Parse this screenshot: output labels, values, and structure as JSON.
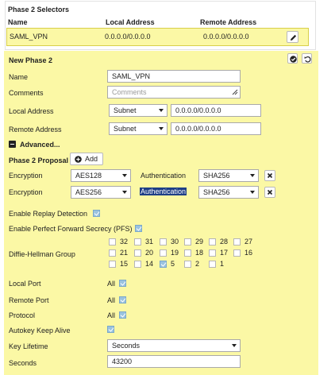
{
  "selectors": {
    "title": "Phase 2 Selectors",
    "headers": {
      "name": "Name",
      "local": "Local Address",
      "remote": "Remote Address"
    },
    "row": {
      "name": "SAML_VPN",
      "local": "0.0.0.0/0.0.0.0",
      "remote": "0.0.0.0/0.0.0.0"
    }
  },
  "panel": {
    "title": "New Phase 2",
    "name": {
      "label": "Name",
      "value": "SAML_VPN"
    },
    "comments": {
      "label": "Comments",
      "placeholder": "Comments"
    },
    "local": {
      "label": "Local Address",
      "type": "Subnet",
      "value": "0.0.0.0/0.0.0.0"
    },
    "remote": {
      "label": "Remote Address",
      "type": "Subnet",
      "value": "0.0.0.0/0.0.0.0"
    },
    "advanced": "Advanced...",
    "proposal": {
      "label": "Phase 2 Proposal",
      "add": "Add",
      "rows": [
        {
          "enc_label": "Encryption",
          "enc": "AES128",
          "auth_label": "Authentication",
          "auth": "SHA256"
        },
        {
          "enc_label": "Encryption",
          "enc": "AES256",
          "auth_label": "Authentication",
          "auth": "SHA256"
        }
      ]
    },
    "replay": {
      "label": "Enable Replay Detection",
      "checked": true
    },
    "pfs": {
      "label": "Enable Perfect Forward Secrecy (PFS)",
      "checked": true
    },
    "dh": {
      "label": "Diffie-Hellman Group",
      "groups": [
        {
          "n": "32",
          "checked": false
        },
        {
          "n": "31",
          "checked": false
        },
        {
          "n": "30",
          "checked": false
        },
        {
          "n": "29",
          "checked": false
        },
        {
          "n": "28",
          "checked": false
        },
        {
          "n": "27",
          "checked": false
        },
        {
          "n": "21",
          "checked": false
        },
        {
          "n": "20",
          "checked": false
        },
        {
          "n": "19",
          "checked": false
        },
        {
          "n": "18",
          "checked": false
        },
        {
          "n": "17",
          "checked": false
        },
        {
          "n": "16",
          "checked": false
        },
        {
          "n": "15",
          "checked": false
        },
        {
          "n": "14",
          "checked": false
        },
        {
          "n": "5",
          "checked": true
        },
        {
          "n": "2",
          "checked": false
        },
        {
          "n": "1",
          "checked": false
        }
      ]
    },
    "local_port": {
      "label": "Local Port",
      "value": "All",
      "checked": true
    },
    "remote_port": {
      "label": "Remote Port",
      "value": "All",
      "checked": true
    },
    "protocol": {
      "label": "Protocol",
      "value": "All",
      "checked": true
    },
    "autokey": {
      "label": "Autokey Keep Alive",
      "checked": true
    },
    "key_lifetime": {
      "label": "Key Lifetime",
      "value": "Seconds"
    },
    "seconds": {
      "label": "Seconds",
      "value": "43200"
    }
  },
  "colors": {
    "highlight": "#fbf8a5",
    "selected_text_bg": "#1e3f86",
    "checkbox": "#9bc3df"
  }
}
